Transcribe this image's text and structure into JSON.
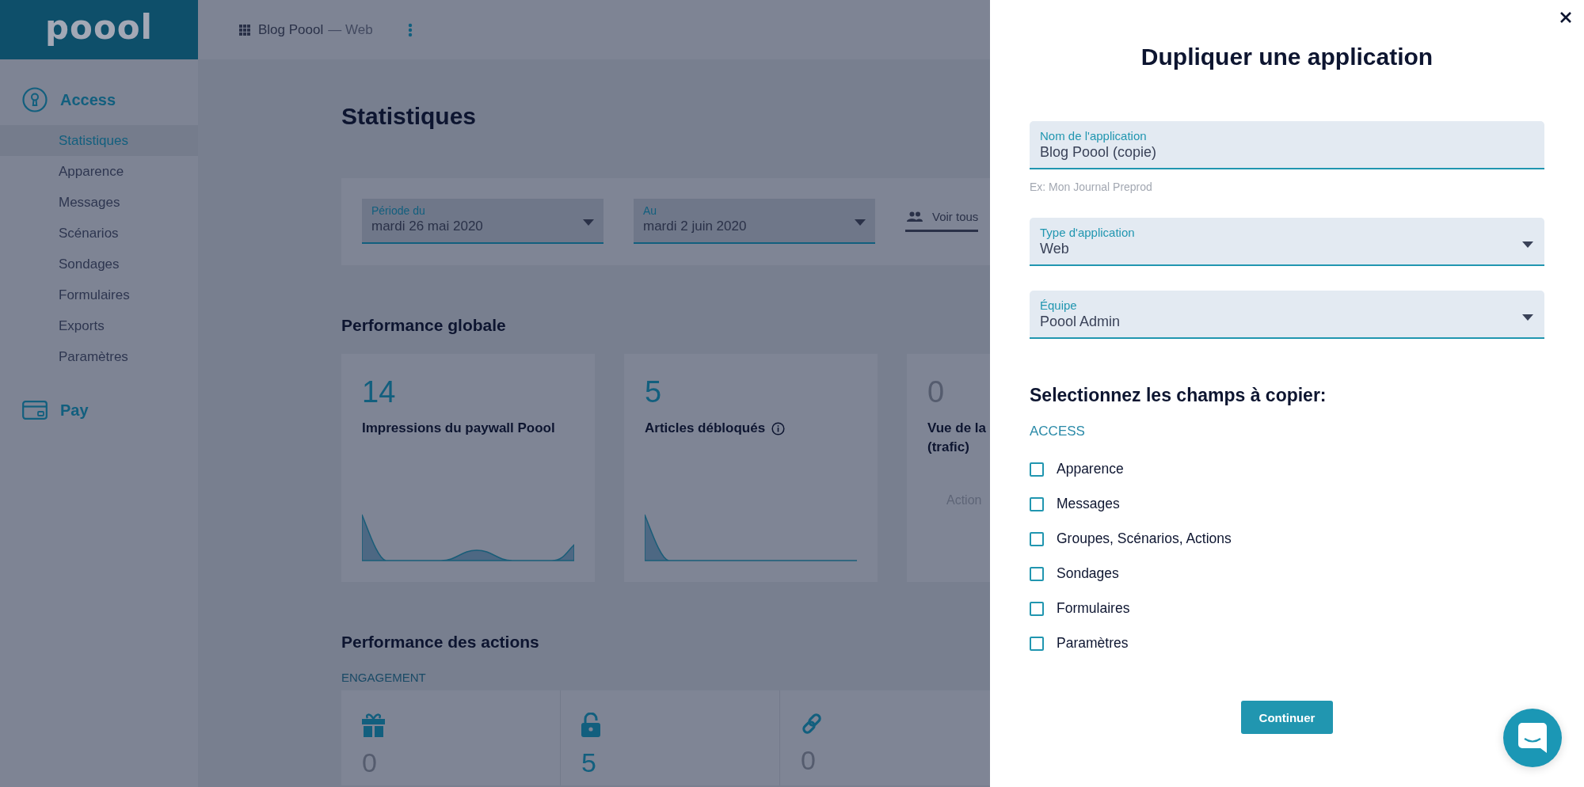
{
  "header": {
    "logo": "poool",
    "app_name": "Blog Poool",
    "app_type": "— Web"
  },
  "sidebar": {
    "sections": [
      {
        "kind": "access",
        "title": "Access",
        "items": [
          {
            "label": "Statistiques",
            "selected": true
          },
          {
            "label": "Apparence",
            "selected": false
          },
          {
            "label": "Messages",
            "selected": false
          },
          {
            "label": "Scénarios",
            "selected": false
          },
          {
            "label": "Sondages",
            "selected": false
          },
          {
            "label": "Formulaires",
            "selected": false
          },
          {
            "label": "Exports",
            "selected": false
          },
          {
            "label": "Paramètres",
            "selected": false
          }
        ]
      },
      {
        "kind": "pay",
        "title": "Pay"
      }
    ]
  },
  "page": {
    "title": "Statistiques",
    "filters": [
      {
        "label": "Période du",
        "value": "mardi 26 mai 2020"
      },
      {
        "label": "Au",
        "value": "mardi 2 juin 2020"
      }
    ],
    "audience_filter": "Voir tous",
    "global": {
      "title": "Performance globale",
      "cards": [
        {
          "kind": "chart",
          "value": "14",
          "muted": false,
          "label_lines": [
            "Impressions du paywall Poool"
          ]
        },
        {
          "kind": "chart",
          "value": "5",
          "muted": false,
          "label_lines": [
            "Articles débloqués"
          ],
          "info": true
        },
        {
          "kind": "empty",
          "value": "0",
          "muted": true,
          "label_lines": [
            "Vue de la",
            "(trafic)"
          ],
          "empty_text": "Action"
        }
      ]
    },
    "actions": {
      "title": "Performance des actions",
      "category": "ENGAGEMENT",
      "items": [
        {
          "kind": "gift",
          "value": "0",
          "muted": true
        },
        {
          "kind": "lock",
          "value": "5",
          "muted": false
        },
        {
          "kind": "link",
          "value": "0",
          "muted": true
        }
      ]
    }
  },
  "modal": {
    "title": "Dupliquer une application",
    "fields": [
      {
        "kind": "text",
        "label": "Nom de l'application",
        "value": "Blog Poool (copie)",
        "helper": "Ex: Mon Journal Preprod"
      },
      {
        "kind": "select",
        "label": "Type d'application",
        "value": "Web"
      },
      {
        "kind": "select",
        "label": "Équipe",
        "value": "Poool Admin"
      }
    ],
    "copy_section": {
      "title": "Selectionnez les champs à copier:",
      "group": "ACCESS",
      "options": [
        {
          "label": "Apparence",
          "checked": false
        },
        {
          "label": "Messages",
          "checked": false
        },
        {
          "label": "Groupes, Scénarios, Actions",
          "checked": false
        },
        {
          "label": "Sondages",
          "checked": false
        },
        {
          "label": "Formulaires",
          "checked": false
        },
        {
          "label": "Paramètres",
          "checked": false
        }
      ]
    },
    "submit": "Continuer"
  }
}
